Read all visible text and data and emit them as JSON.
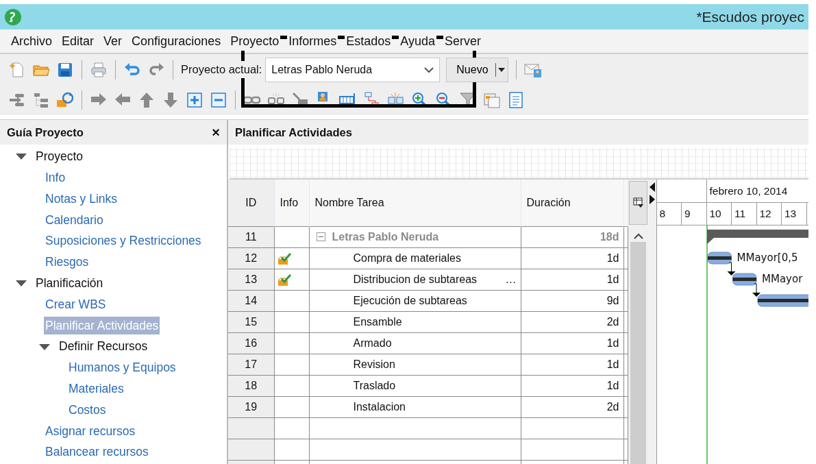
{
  "window": {
    "title": "*Escudos proyec"
  },
  "menu": [
    "Archivo",
    "Editar",
    "Ver",
    "Configuraciones",
    "Proyecto",
    "Informes",
    "Estados",
    "Ayuda",
    "Server"
  ],
  "toolbar": {
    "project_label": "Proyecto actual:",
    "project_value": "Letras Pablo Neruda",
    "new_button": "Nuevo"
  },
  "sidebar": {
    "title": "Guía Proyecto",
    "close": "×",
    "items": [
      {
        "label": "Proyecto",
        "expanded": true,
        "selected": false,
        "children": [
          {
            "label": "Info",
            "selected": false
          },
          {
            "label": "Notas y Links",
            "selected": false
          },
          {
            "label": "Calendario",
            "selected": false
          },
          {
            "label": "Suposiciones y Restricciones",
            "selected": false
          },
          {
            "label": "Riesgos",
            "selected": false
          }
        ]
      },
      {
        "label": "Planificación",
        "expanded": true,
        "selected": false,
        "children": [
          {
            "label": "Crear WBS",
            "selected": false
          },
          {
            "label": "Planificar Actividades",
            "selected": true
          },
          {
            "label": "Definir Recursos",
            "expanded": true,
            "selected": false,
            "children": [
              {
                "label": "Humanos y Equipos",
                "selected": false
              },
              {
                "label": "Materiales",
                "selected": false
              },
              {
                "label": "Costos",
                "selected": false
              }
            ]
          },
          {
            "label": "Asignar recursos",
            "selected": false
          },
          {
            "label": "Balancear recursos",
            "selected": false
          }
        ]
      }
    ]
  },
  "main": {
    "title": "Planificar Actividades",
    "table": {
      "columns": [
        "ID",
        "Info",
        "Nombre Tarea",
        "Duración"
      ],
      "rows": [
        {
          "id": "11",
          "kind": "summary",
          "expanded": true,
          "info": false,
          "name": "Letras Pablo Neruda",
          "duration": "18d"
        },
        {
          "id": "12",
          "kind": "task",
          "info": true,
          "name": "Compra de materiales",
          "duration": "1d"
        },
        {
          "id": "13",
          "kind": "task",
          "info": true,
          "name": "Distribucion de subtareas",
          "more": "…",
          "duration": "1d"
        },
        {
          "id": "14",
          "kind": "task",
          "info": false,
          "name": "Ejecución de subtareas",
          "duration": "9d"
        },
        {
          "id": "15",
          "kind": "task",
          "info": false,
          "name": "Ensamble",
          "duration": "2d"
        },
        {
          "id": "16",
          "kind": "task",
          "info": false,
          "name": "Armado",
          "duration": "1d"
        },
        {
          "id": "17",
          "kind": "task",
          "info": false,
          "name": "Revision",
          "duration": "1d"
        },
        {
          "id": "18",
          "kind": "task",
          "info": false,
          "name": "Traslado",
          "duration": "1d"
        },
        {
          "id": "19",
          "kind": "task",
          "info": false,
          "name": "Instalacion",
          "duration": "2d"
        }
      ]
    },
    "gantt": {
      "period": "febrero 10, 2014",
      "days": [
        "8",
        "9",
        "10",
        "11",
        "12",
        "13"
      ],
      "links": [
        {
          "label": "MMayor[0,5"
        },
        {
          "label": "MMayor"
        }
      ]
    }
  }
}
